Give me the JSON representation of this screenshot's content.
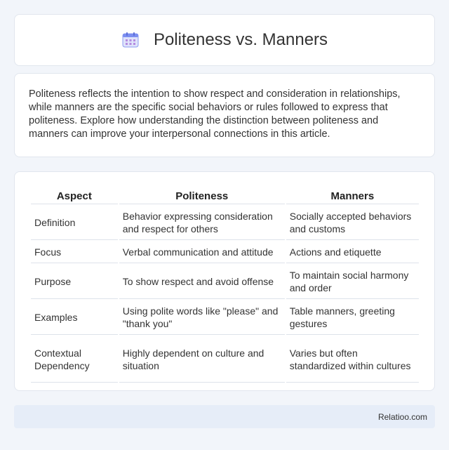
{
  "header": {
    "title": "Politeness vs. Manners",
    "icon": "calendar-icon"
  },
  "intro": {
    "text": "Politeness reflects the intention to show respect and consideration in relationships, while manners are the specific social behaviors or rules followed to express that politeness. Explore how understanding the distinction between politeness and manners can improve your interpersonal connections in this article."
  },
  "table": {
    "headers": [
      "Aspect",
      "Politeness",
      "Manners"
    ],
    "rows": [
      [
        "Definition",
        "Behavior expressing consideration and respect for others",
        "Socially accepted behaviors and customs"
      ],
      [
        "Focus",
        "Verbal communication and attitude",
        "Actions and etiquette"
      ],
      [
        "Purpose",
        "To show respect and avoid offense",
        "To maintain social harmony and order"
      ],
      [
        "Examples",
        "Using polite words like \"please\" and \"thank you\"",
        "Table manners, greeting gestures"
      ],
      [
        "Contextual Dependency",
        "Highly dependent on culture and situation",
        "Varies but often standardized within cultures"
      ]
    ]
  },
  "footer": {
    "text": "Relatioo.com"
  },
  "colors": {
    "background": "#f2f5fa",
    "card": "#ffffff",
    "footer_bg": "#e6edf8",
    "icon_accent": "#7b8ef0"
  }
}
